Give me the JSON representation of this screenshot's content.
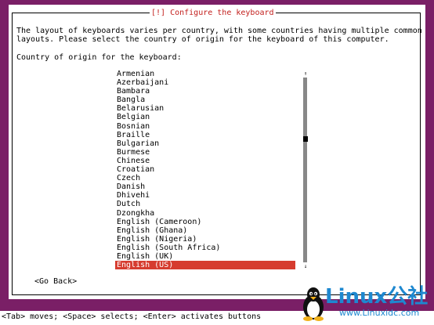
{
  "dialog": {
    "title": "[!] Configure the keyboard",
    "description": "The layout of keyboards varies per country, with some countries having multiple common\nlayouts. Please select the country of origin for the keyboard of this computer.",
    "prompt": "Country of origin for the keyboard:",
    "countries": [
      "Armenian",
      "Azerbaijani",
      "Bambara",
      "Bangla",
      "Belarusian",
      "Belgian",
      "Bosnian",
      "Braille",
      "Bulgarian",
      "Burmese",
      "Chinese",
      "Croatian",
      "Czech",
      "Danish",
      "Dhivehi",
      "Dutch",
      "Dzongkha",
      "English (Cameroon)",
      "English (Ghana)",
      "English (Nigeria)",
      "English (South Africa)",
      "English (UK)",
      "English (US)"
    ],
    "selected_country": "English (US)",
    "go_back_label": "<Go Back>"
  },
  "scrollbar": {
    "up_arrow": "↑",
    "down_arrow": "↓"
  },
  "help_bar": {
    "text": "<Tab> moves; <Space> selects; <Enter> activates buttons"
  },
  "watermark": {
    "brand": "Linux公社",
    "url": "www.Linuxidc.com",
    "icon": "tux-penguin-icon"
  },
  "colors": {
    "background": "#7a1f66",
    "dialog": "#ffffff",
    "title_text": "#c3201e",
    "selection": "#d63c2f",
    "scroll_track": "#888888",
    "watermark": "#1e88d0"
  }
}
